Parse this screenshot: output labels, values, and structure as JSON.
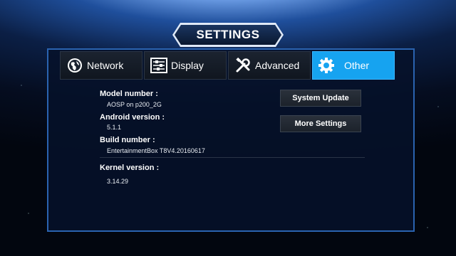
{
  "title": "SETTINGS",
  "tabs": [
    {
      "label": "Network",
      "icon": "globe-icon"
    },
    {
      "label": "Display",
      "icon": "sliders-icon"
    },
    {
      "label": "Advanced",
      "icon": "tools-icon"
    },
    {
      "label": "Other",
      "icon": "gear-icon",
      "active": true
    }
  ],
  "info": {
    "model_label": "Model number :",
    "model_value": "AOSP on p200_2G",
    "android_label": "Android version :",
    "android_value": "5.1.1",
    "build_label": "Build number :",
    "build_value": "EntertainmentBox T8V4.20160617",
    "kernel_label": "Kernel version :",
    "kernel_value": "3.14.29"
  },
  "buttons": {
    "system_update": "System Update",
    "more_settings": "More Settings"
  },
  "colors": {
    "accent": "#16a3f0",
    "panel_border": "#2a63b0"
  }
}
